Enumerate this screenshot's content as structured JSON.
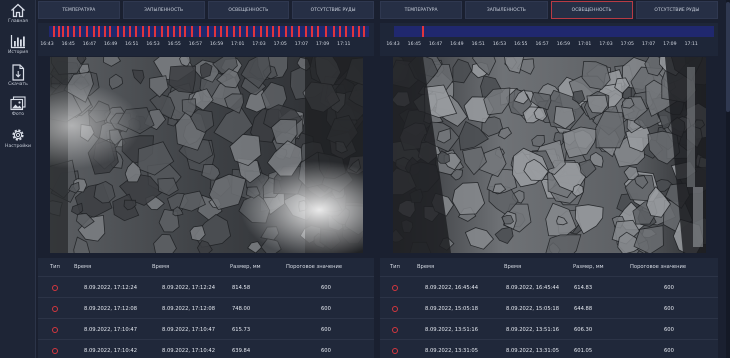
{
  "sidebar": {
    "items": [
      {
        "icon": "home-icon",
        "label": "Главная"
      },
      {
        "icon": "history-chart-icon",
        "label": "История"
      },
      {
        "icon": "document-download-icon",
        "label": "Скачать"
      },
      {
        "icon": "photo-icon",
        "label": "Фото"
      },
      {
        "icon": "gear-icon",
        "label": "Настройки"
      }
    ]
  },
  "left_panel": {
    "tabs": [
      "Температура",
      "Запыленность",
      "Освещенность",
      "Отсутствие руды"
    ],
    "active_tab": null,
    "timeline_ticks": [
      "16:43",
      "16:45",
      "16:47",
      "16:49",
      "16:51",
      "16:53",
      "16:55",
      "16:57",
      "16:59",
      "17:01",
      "17:03",
      "17:05",
      "17:07",
      "17:09",
      "17:11"
    ],
    "table": {
      "headers": [
        "Тип",
        "Время",
        "Время",
        "Размер, мм",
        "Пороговое значение"
      ],
      "rows": [
        [
          "8.09.2022, 17:12:24",
          "8.09.2022, 17:12:24",
          "814.58",
          "600"
        ],
        [
          "8.09.2022, 17:12:08",
          "8.09.2022, 17:12:08",
          "748.00",
          "600"
        ],
        [
          "8.09.2022, 17:10:47",
          "8.09.2022, 17:10:47",
          "615.73",
          "600"
        ],
        [
          "8.09.2022, 17:10:42",
          "8.09.2022, 17:10:42",
          "639.84",
          "600"
        ]
      ]
    }
  },
  "right_panel": {
    "tabs": [
      "Температура",
      "Запыленность",
      "Освещенность",
      "Отсутствие руды"
    ],
    "active_tab": 2,
    "timeline_ticks": [
      "16:43",
      "16:45",
      "16:47",
      "16:49",
      "16:51",
      "16:53",
      "16:55",
      "16:57",
      "16:59",
      "17:01",
      "17:03",
      "17:05",
      "17:07",
      "17:09",
      "17:11"
    ],
    "table": {
      "headers": [
        "Тип",
        "Время",
        "Время",
        "Размер, мм",
        "Пороговое значение"
      ],
      "rows": [
        [
          "8.09.2022, 16:45:44",
          "8.09.2022, 16:45:44",
          "614.83",
          "600"
        ],
        [
          "8.09.2022, 15:05:18",
          "8.09.2022, 15:05:18",
          "644.88",
          "600"
        ],
        [
          "8.09.2022, 13:51:16",
          "8.09.2022, 13:51:16",
          "606.30",
          "600"
        ],
        [
          "8.09.2022, 13:31:05",
          "8.09.2022, 13:31:05",
          "601.05",
          "600"
        ]
      ]
    }
  },
  "colors": {
    "background": "#1a2030",
    "panel": "#20283a",
    "timeline_bar": "#20286e",
    "event_marker": "#e2343c",
    "active_tab_border": "#b73b44"
  }
}
